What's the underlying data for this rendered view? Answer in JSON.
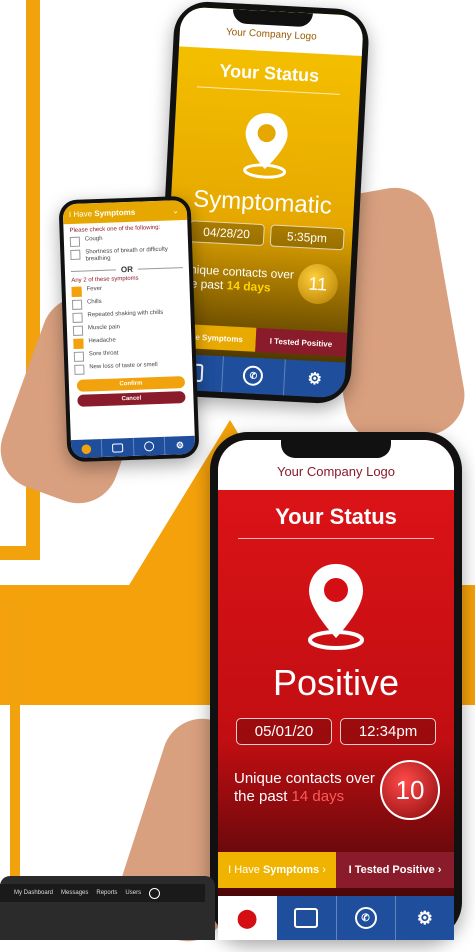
{
  "phone_top": {
    "logo": "Your Company Logo",
    "status_title": "Your Status",
    "status": "Symptomatic",
    "date": "04/28/20",
    "time": "5:35pm",
    "contacts_line1": "Unique contacts over",
    "contacts_line2_prefix": "the past",
    "contacts_days": "14 days",
    "contacts_count": "11",
    "btn_symptoms": "I Have Symptoms",
    "btn_positive": "I Tested Positive",
    "colors": {
      "bg": "#f0b400",
      "accent": "#8a1b2b"
    }
  },
  "phone_small": {
    "header_prefix": "I Have",
    "header_bold": "Symptoms",
    "instruction": "Please check one of the following:",
    "group1": [
      {
        "label": "Cough",
        "checked": false
      },
      {
        "label": "Shortness of breath or difficulty breathing",
        "checked": false
      }
    ],
    "or_label": "OR",
    "group2_title": "Any 2 of these symptoms",
    "group2": [
      {
        "label": "Fever",
        "checked": true
      },
      {
        "label": "Chills",
        "checked": false
      },
      {
        "label": "Repeated shaking with chills",
        "checked": false
      },
      {
        "label": "Muscle pain",
        "checked": false
      },
      {
        "label": "Headache",
        "checked": true
      },
      {
        "label": "Sore throat",
        "checked": false
      },
      {
        "label": "New loss of taste or smell",
        "checked": false
      }
    ],
    "confirm": "Confirm",
    "cancel": "Cancel"
  },
  "phone_big": {
    "logo": "Your Company Logo",
    "status_title": "Your Status",
    "status": "Positive",
    "date": "05/01/20",
    "time": "12:34pm",
    "contacts_line1": "Unique contacts over",
    "contacts_line2_prefix": "the past",
    "contacts_days": "14 days",
    "contacts_count": "10",
    "btn_symptoms_prefix": "I Have",
    "btn_symptoms_bold": "Symptoms",
    "btn_positive": "I Tested Positive",
    "colors": {
      "bg": "#d40f14",
      "navbar": "#1e4e9c"
    }
  },
  "laptop": {
    "nav": [
      "My Dashboard",
      "Messages",
      "Reports",
      "Users"
    ]
  },
  "icons": [
    "location-pin-icon",
    "camera-icon",
    "phone-icon",
    "gear-icon"
  ]
}
